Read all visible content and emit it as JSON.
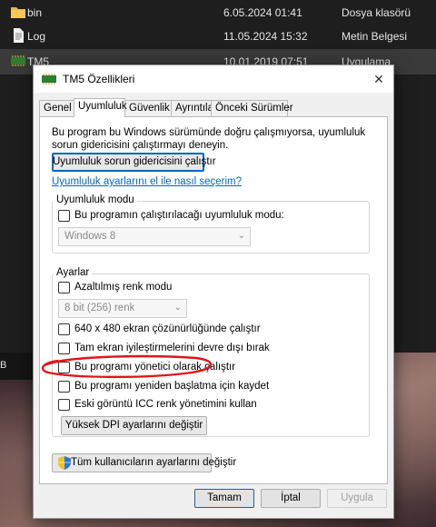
{
  "explorer": {
    "files": [
      {
        "name": "bin",
        "date": "6.05.2024 01:41",
        "type": "Dosya klasörü",
        "icon": "folder-icon"
      },
      {
        "name": "Log",
        "date": "11.05.2024 15:32",
        "type": "Metin Belgesi",
        "icon": "text-document-icon"
      },
      {
        "name": "TM5",
        "date": "10.01.2019 07:51",
        "type": "Uygulama",
        "icon": "application-icon"
      }
    ],
    "strip_text": "B"
  },
  "dialog": {
    "title": "TM5 Özellikleri",
    "close_glyph": "✕",
    "tabs": [
      "Genel",
      "Uyumluluk",
      "Güvenlik",
      "Ayrıntılar",
      "Önceki Sürümler"
    ],
    "active_tab": "Uyumluluk",
    "description": "Bu program bu Windows sürümünde doğru çalışmıyorsa, uyumluluk sorun gidericisini çalıştırmayı deneyin.",
    "troubleshooter_button": "Uyumluluk sorun gidericisini çalıştır",
    "manual_link": "Uyumluluk ayarlarını el ile nasıl seçerim?",
    "compat_mode": {
      "group_label": "Uyumluluk modu",
      "checkbox_label": "Bu programın çalıştırılacağı uyumluluk modu:",
      "checked": false,
      "select_value": "Windows 8"
    },
    "settings": {
      "group_label": "Ayarlar",
      "reduced_color_label": "Azaltılmış renk modu",
      "color_select_value": "8 bit (256) renk",
      "res_label": "640 x 480 ekran çözünürlüğünde çalıştır",
      "fullscreen_label": "Tam ekran iyileştirmelerini devre dışı bırak",
      "admin_label": "Bu programı yönetici olarak çalıştır",
      "restart_label": "Bu programı yeniden başlatma için kaydet",
      "icc_label": "Eski görüntü ICC renk yönetimini kullan",
      "dpi_button": "Yüksek DPI ayarlarını değiştir"
    },
    "all_users_button": "Tüm kullanıcıların ayarlarını değiştir",
    "buttons": {
      "ok": "Tamam",
      "cancel": "İptal",
      "apply": "Uygula"
    }
  },
  "colors": {
    "annotation": "#e0161b",
    "link": "#0066cc",
    "accent": "#0067c0"
  }
}
